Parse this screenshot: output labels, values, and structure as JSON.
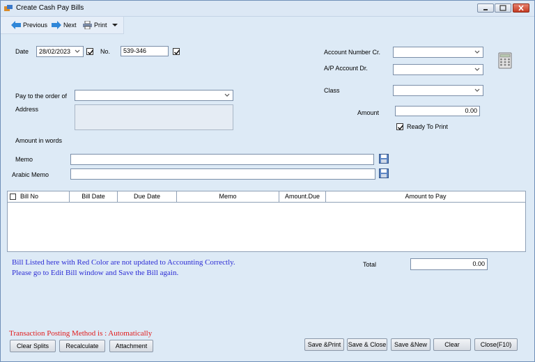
{
  "window": {
    "title": "Create Cash Pay Bills"
  },
  "toolbar": {
    "previous": "Previous",
    "next": "Next",
    "print": "Print"
  },
  "form": {
    "date_label": "Date",
    "date_value": "28/02/2023",
    "no_label": "No.",
    "no_value": "539-346",
    "account_cr_label": "Account Number Cr.",
    "ap_account_label": "A/P Account Dr.",
    "class_label": "Class",
    "amount_label": "Amount",
    "amount_value": "0.00",
    "ready_to_print_label": "Ready To Print",
    "pay_to_label": "Pay to the order of",
    "address_label": "Address",
    "amount_words_label": "Amount in words",
    "memo_label": "Memo",
    "arabic_memo_label": "Arabic Memo"
  },
  "grid": {
    "columns": [
      "Bill No",
      "Bill Date",
      "Due Date",
      "Memo",
      "Amount.Due",
      "Amount to Pay"
    ]
  },
  "notes": {
    "line1": "Bill Listed here with Red Color are not updated to Accounting Correctly.",
    "line2": "Please go to Edit Bill window and Save the Bill again.",
    "posting": "Transaction Posting Method is : Automatically"
  },
  "totals": {
    "label": "Total",
    "value": "0.00"
  },
  "buttons": {
    "clear_splits": "Clear Splits",
    "recalculate": "Recalculate",
    "attachment": "Attachment",
    "save_print": "Save &Print",
    "save_close": "Save & Close",
    "save_new": "Save &New",
    "clear": "Clear",
    "close": "Close(F10)"
  },
  "colors": {
    "note_blue": "#2b2bd4",
    "posting_red": "#e21b1b",
    "window_bg": "#ddeaf6"
  }
}
